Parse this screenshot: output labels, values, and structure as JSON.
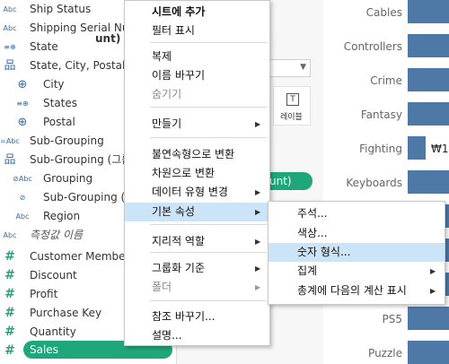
{
  "fields": [
    {
      "icon": "Abc",
      "icon_name": "string-icon",
      "label": "Ship Status"
    },
    {
      "icon": "Abc",
      "icon_name": "string-icon",
      "label": "Shipping Serial Nu"
    },
    {
      "icon": "≡⊕",
      "icon_name": "geo-icon",
      "label": "State"
    },
    {
      "icon": "品",
      "icon_name": "hierarchy-icon",
      "label": "State, City, Postal C"
    },
    {
      "icon": "⊕",
      "icon_name": "geo-icon",
      "label": "City"
    },
    {
      "icon": "≡⊕",
      "icon_name": "geo-icon",
      "label": "States"
    },
    {
      "icon": "⊕",
      "icon_name": "geo-icon",
      "label": "Postal"
    },
    {
      "icon": "=Abc",
      "icon_name": "group-icon",
      "label": "Sub-Grouping"
    },
    {
      "icon": "品",
      "icon_name": "hierarchy-icon",
      "label": "Sub-Grouping (그룹"
    },
    {
      "icon": "⊘Abc",
      "icon_name": "group-icon",
      "label": "Grouping"
    },
    {
      "icon": "⊘",
      "icon_name": "group-icon",
      "label": "Sub-Grouping ("
    },
    {
      "icon": "Abc",
      "icon_name": "string-icon",
      "label": "Region"
    },
    {
      "icon": "Abc",
      "icon_name": "string-icon",
      "label": "측정값 이름"
    },
    {
      "icon": "#",
      "icon_name": "measure-icon",
      "label": "Customer Member"
    },
    {
      "icon": "#",
      "icon_name": "measure-icon",
      "label": "Discount"
    },
    {
      "icon": "#",
      "icon_name": "measure-icon",
      "label": "Profit"
    },
    {
      "icon": "#",
      "icon_name": "measure-icon",
      "label": "Purchase Key"
    },
    {
      "icon": "#",
      "icon_name": "measure-icon",
      "label": "Quantity"
    },
    {
      "icon": "#",
      "icon_name": "measure-icon",
      "label": "Sales"
    }
  ],
  "card": {
    "title": "unt)",
    "label_button": "레이블",
    "pill_text": "unt)"
  },
  "chart_data": {
    "type": "bar",
    "categories": [
      "Cables",
      "Controllers",
      "Crime",
      "Fantasy",
      "Fighting",
      "Keyboards",
      "PS5",
      "Puzzle"
    ],
    "visible_labels": {
      "Fighting": "₩1"
    },
    "bar_color": "#4e79a7"
  },
  "menu": {
    "items": [
      {
        "label": "시트에 추가",
        "name": "menu-add-to-sheet",
        "bold": true
      },
      {
        "label": "필터 표시",
        "name": "menu-show-filter"
      },
      {
        "label": "복제",
        "name": "menu-duplicate"
      },
      {
        "label": "이름 바꾸기",
        "name": "menu-rename"
      },
      {
        "label": "숨기기",
        "name": "menu-hide",
        "disabled": true
      },
      {
        "label": "만들기",
        "name": "menu-create",
        "arrow": true
      },
      {
        "label": "불연속형으로 변환",
        "name": "menu-convert-discrete"
      },
      {
        "label": "차원으로 변환",
        "name": "menu-convert-dimension"
      },
      {
        "label": "데이터 유형 변경",
        "name": "menu-change-data-type",
        "arrow": true
      },
      {
        "label": "기본 속성",
        "name": "menu-default-properties",
        "arrow": true,
        "highlight": true
      },
      {
        "label": "지리적 역할",
        "name": "menu-geographic-role",
        "arrow": true
      },
      {
        "label": "그룹화 기준",
        "name": "menu-group-by",
        "arrow": true
      },
      {
        "label": "폴더",
        "name": "menu-folders",
        "arrow": true,
        "disabled": true
      },
      {
        "label": "참조 바꾸기...",
        "name": "menu-replace-references"
      },
      {
        "label": "설명...",
        "name": "menu-describe"
      }
    ]
  },
  "submenu": {
    "items": [
      {
        "label": "주석...",
        "name": "submenu-comment"
      },
      {
        "label": "색상...",
        "name": "submenu-color"
      },
      {
        "label": "숫자 형식...",
        "name": "submenu-number-format",
        "highlight": true
      },
      {
        "label": "집계",
        "name": "submenu-aggregation",
        "arrow": true
      },
      {
        "label": "총계에 다음의 계산 표시",
        "name": "submenu-total-using",
        "arrow": true
      }
    ]
  }
}
